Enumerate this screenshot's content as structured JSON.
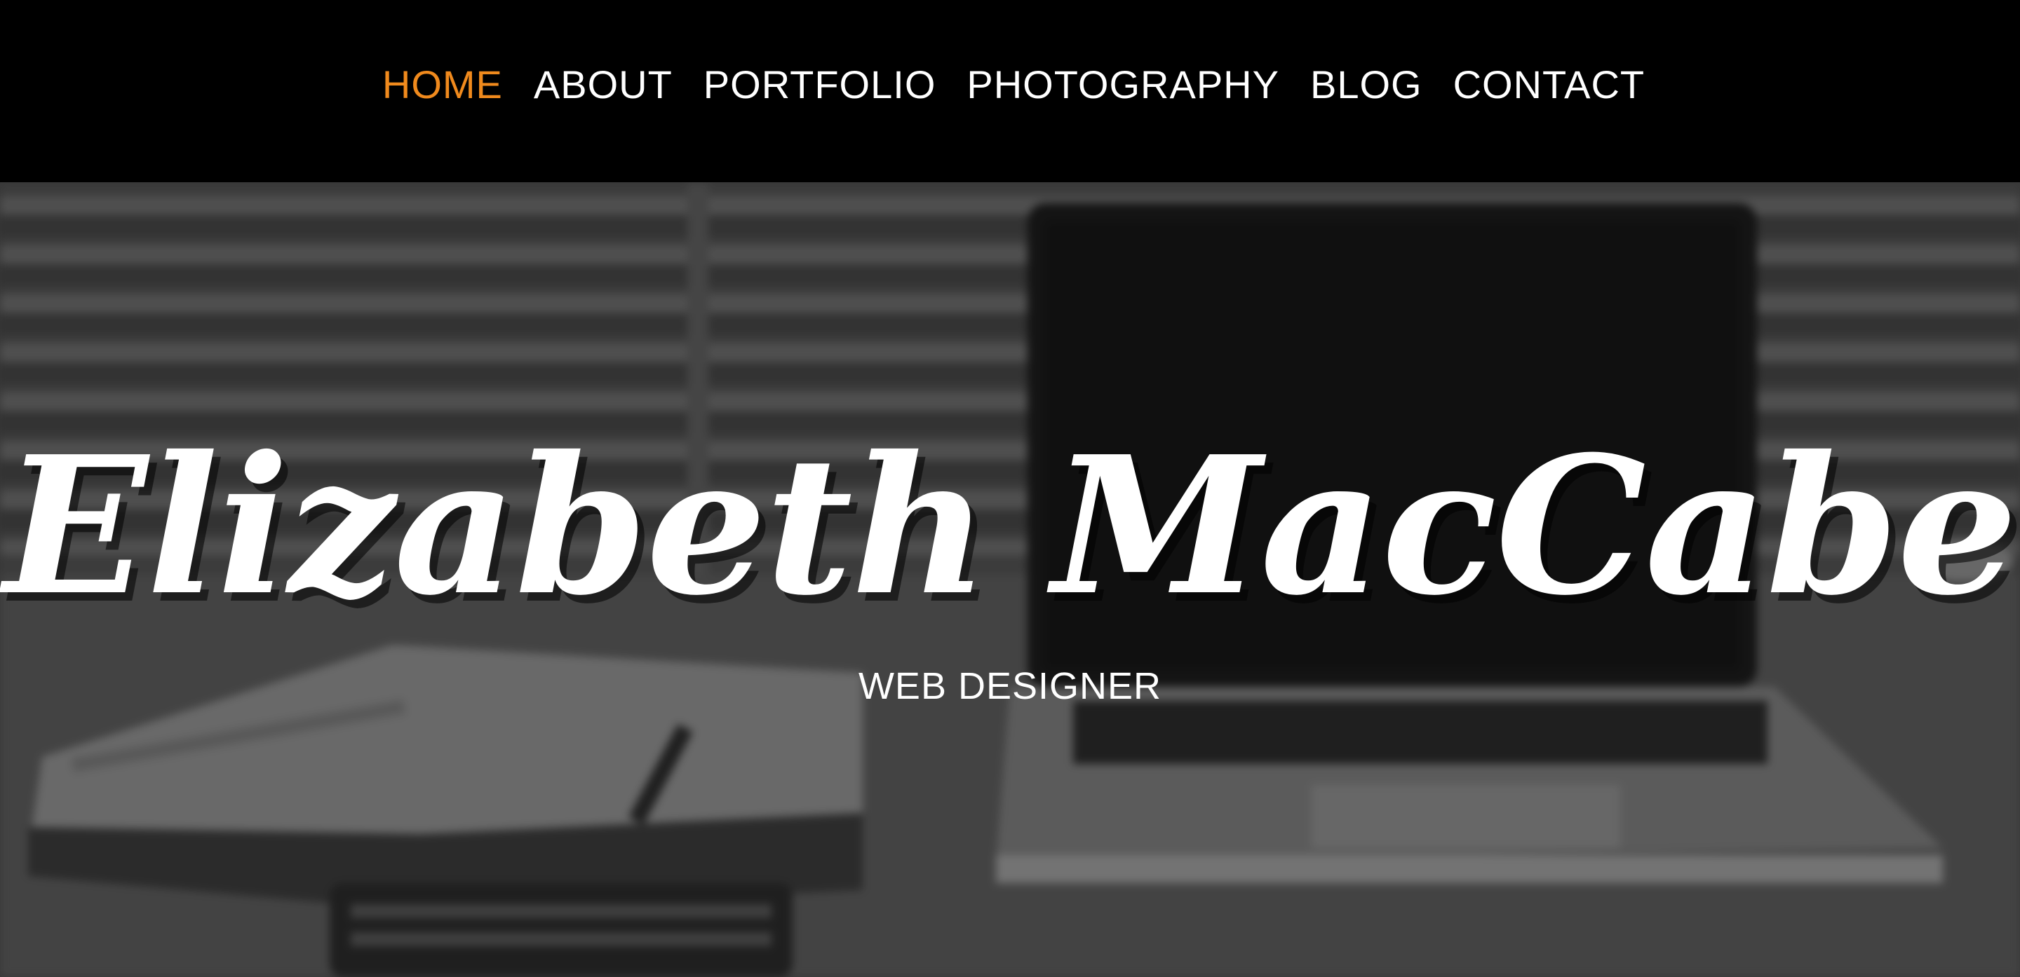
{
  "nav": {
    "items": [
      {
        "label": "HOME",
        "active": true
      },
      {
        "label": "ABOUT",
        "active": false
      },
      {
        "label": "PORTFOLIO",
        "active": false
      },
      {
        "label": "PHOTOGRAPHY",
        "active": false
      },
      {
        "label": "BLOG",
        "active": false
      },
      {
        "label": "CONTACT",
        "active": false
      }
    ],
    "active_color": "#f08a1d",
    "text_color": "#ffffff",
    "background": "#000000"
  },
  "hero": {
    "name": "Elizabeth MacCabe",
    "subtitle": "WEB DESIGNER",
    "background_description_icon": "blurred-desk-photo"
  }
}
